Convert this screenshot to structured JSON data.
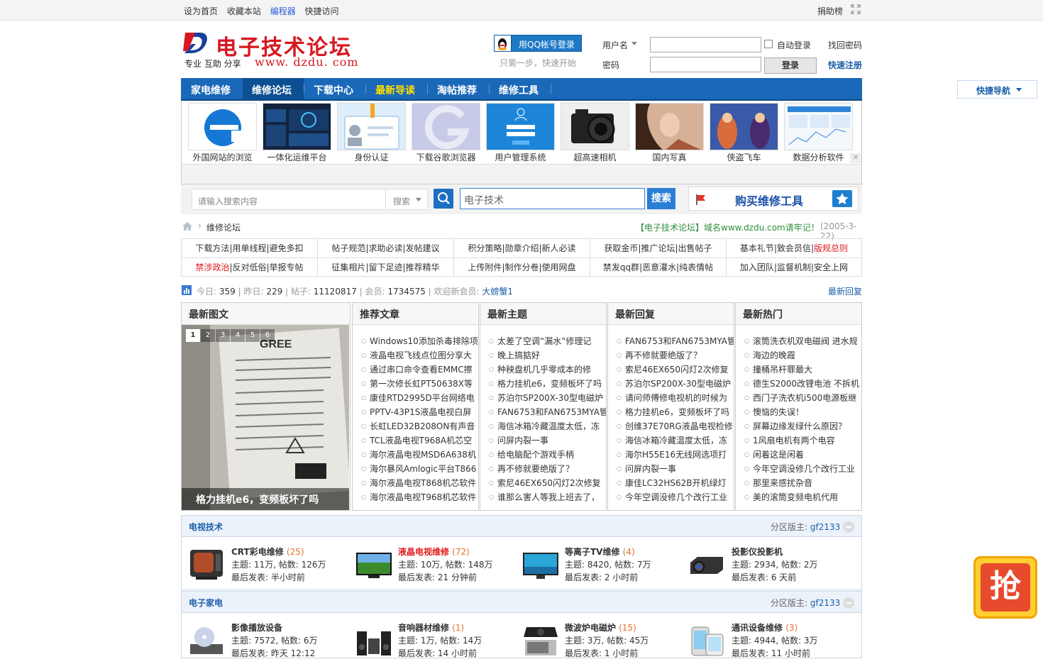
{
  "topbar": {
    "links": [
      "设为首页",
      "收藏本站",
      "编程器",
      "快捷访问"
    ],
    "right": "捐助榜"
  },
  "header": {
    "site_title": "电子技术论坛",
    "slogan": "专业 互助 分享",
    "url": "www. dzdu. com",
    "qq_login": "用QQ帐号登录",
    "qq_note": "只需一步，快速开始",
    "username_label": "用户名",
    "password_label": "密码",
    "auto_login": "自动登录",
    "login_btn": "登录",
    "find_pwd": "找回密码",
    "register": "快速注册"
  },
  "nav": {
    "items": [
      "家电维修",
      "维修论坛",
      "下载中心",
      "最新导读",
      "淘帖推荐",
      "维修工具"
    ],
    "quick": "快捷导航"
  },
  "ads": [
    {
      "label": "外国网站的浏览"
    },
    {
      "label": "一体化运维平台"
    },
    {
      "label": "身份认证"
    },
    {
      "label": "下载谷歌浏览器"
    },
    {
      "label": "用户管理系统"
    },
    {
      "label": "超高速相机"
    },
    {
      "label": "国内写真"
    },
    {
      "label": "侠盗飞车"
    },
    {
      "label": "数据分析软件"
    }
  ],
  "search": {
    "placeholder": "请输入搜索内容",
    "scope": "搜索",
    "query": "电子技术",
    "btn": "搜索",
    "buy": "购买维修工具"
  },
  "crumb": {
    "current": "维修论坛",
    "notice": "【电子技术论坛】域名www.dzdu.com请牢记！",
    "date": "(2005-3-22)"
  },
  "rules": [
    [
      "下载方法",
      "用单线程",
      "避免多扣"
    ],
    [
      "帖子规范",
      "求助必读",
      "发帖建议"
    ],
    [
      "积分策略",
      "勋章介绍",
      "新人必读"
    ],
    [
      "获取金币",
      "推广论坛",
      "出售帖子"
    ],
    [
      "基本礼节",
      "致会员信",
      "版规总则"
    ],
    [
      "禁涉政治",
      "反对低俗",
      "举报专帖"
    ],
    [
      "征集相片",
      "留下足迹",
      "推荐精华"
    ],
    [
      "上传附件",
      "制作分卷",
      "使用网盘"
    ],
    [
      "禁发qq群",
      "恶意灌水",
      "纯表情帖"
    ],
    [
      "加入团队",
      "监督机制",
      "安全上网"
    ]
  ],
  "stats": {
    "today_label": "今日:",
    "today": "359",
    "yest_label": "昨日:",
    "yest": "229",
    "posts_label": "帖子:",
    "posts": "11120817",
    "members_label": "会员:",
    "members": "1734575",
    "welcome": "欢迎新会员:",
    "newest": "大螃蟹1",
    "latest": "最新回复"
  },
  "panels": {
    "pics_title": "最新图文",
    "slide_caption": "格力挂机e6，变频板坏了吗",
    "slide_nums": [
      "1",
      "2",
      "3",
      "4",
      "5",
      "6"
    ],
    "recommend": {
      "title": "推荐文章",
      "items": [
        "Windows10添加杀毒排除项",
        "液晶电视飞线点位图分享大",
        "通过串口命令查看EMMC擦",
        "第一次修长虹PT50638X等",
        "康佳RTD2995D平台网络电",
        "PPTV-43P1S液晶电视白屏",
        "长虹LED32B208ON有声音",
        "TCL液晶电视T968A机芯空",
        "海尔液晶电视MSD6A638机",
        "海尔暴风Amlogic平台T866",
        "海尔液晶电视T868机芯软件",
        "海尔液晶电视T968机芯软件"
      ]
    },
    "new_topics": {
      "title": "最新主题",
      "items": [
        "太差了空调“漏水”修理记",
        "晚上搞掂好",
        "种秧盘机几乎零成本的修",
        "格力挂机e6，变频板坏了吗",
        "苏泊尔SP200X-30型电磁炉",
        "FAN6753和FAN6753MYA管",
        "海信冰箱冷藏温度太低，冻",
        "问屏内裂一事",
        "给电脑配个游戏手柄",
        "再不修就要绝版了？",
        "索尼46EX650闪灯2次修复",
        "谁那么害人等我上班去了，"
      ]
    },
    "new_replies": {
      "title": "最新回复",
      "items": [
        "FAN6753和FAN6753MYA管",
        "再不修就要绝版了？",
        "索尼46EX650闪灯2次修复",
        "苏泊尔SP200X-30型电磁炉",
        "请问师傅修电视机的时候为",
        "格力挂机e6，变频板坏了吗",
        "创维37E70RG液晶电视检修",
        "海信冰箱冷藏温度太低，冻",
        "海尔H55E16无线网选项打",
        "问屏内裂一事",
        "康佳LC32HS62B开机绿灯",
        "今年空调没修几个改行工业"
      ]
    },
    "hot": {
      "title": "最新热门",
      "items": [
        "滚筒洗衣机双电磁阀 进水规",
        "海边的晚霞",
        "撞桶吊杆罪最大",
        "德生S2000改锂电池 不拆机",
        "西门子洗衣机i500电源板继",
        "懊恼的失误！",
        "屏幕边缘发绿什么原因？",
        "1风扇电机有两个电容",
        "闲着这是闲着",
        "今年空调没修几个改行工业",
        "那里来感扰杂音",
        "美的滚筒变频电机代用"
      ]
    }
  },
  "forums": [
    {
      "title": "电视技术",
      "mod_label": "分区版主:",
      "mod": "gf2133",
      "boards": [
        {
          "name": "CRT彩电维修",
          "count": "(25)",
          "topics": "主题: 11万, 帖数: 126万",
          "last": "最后发表: 半小时前",
          "red": false
        },
        {
          "name": "液晶电视维修",
          "count": "(72)",
          "topics": "主题: 10万, 帖数: 148万",
          "last": "最后发表: 21 分钟前",
          "red": true
        },
        {
          "name": "等离子TV维修",
          "count": "(4)",
          "topics": "主题: 8420, 帖数: 7万",
          "last": "最后发表: 2 小时前",
          "red": false
        },
        {
          "name": "投影仪投影机",
          "count": "",
          "topics": "主题: 2934, 帖数: 2万",
          "last": "最后发表: 6 天前",
          "red": false
        }
      ]
    },
    {
      "title": "电子家电",
      "mod_label": "分区版主:",
      "mod": "gf2133",
      "boards": [
        {
          "name": "影像播放设备",
          "count": "",
          "topics": "主题: 7572, 帖数: 6万",
          "last": "最后发表: 昨天 12:12",
          "red": false
        },
        {
          "name": "音响器材维修",
          "count": "(1)",
          "topics": "主题: 1万, 帖数: 14万",
          "last": "最后发表: 14 小时前",
          "red": false
        },
        {
          "name": "微波炉电磁炉",
          "count": "(15)",
          "topics": "主题: 3万, 帖数: 45万",
          "last": "最后发表: 1 小时前",
          "red": false
        },
        {
          "name": "通讯设备维修",
          "count": "(3)",
          "topics": "主题: 4944, 帖数: 3万",
          "last": "最后发表: 11 小时前",
          "red": false
        }
      ]
    }
  ],
  "float_btn": "抢",
  "colors": {
    "nav": "#1a68b8",
    "accent_red": "#d7171f",
    "link": "#1b5ea9",
    "yellow": "#ffde00"
  }
}
